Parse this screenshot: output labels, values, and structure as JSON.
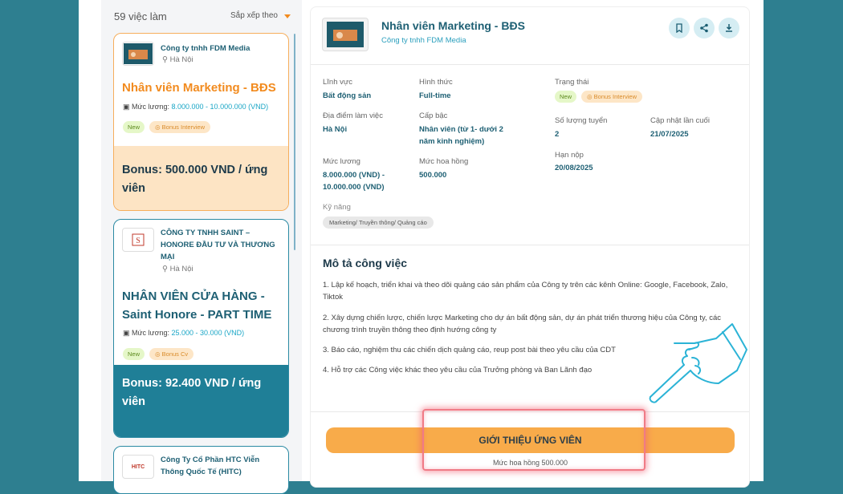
{
  "list": {
    "count": "59 việc làm",
    "sort_label": "Sắp xếp theo",
    "salary_label": "Mức lương:",
    "jobs": [
      {
        "company": "Công ty tnhh FDM Media",
        "location": "Hà Nội",
        "title": "Nhân viên Marketing - BĐS",
        "salary": "8.000.000 - 10.000.000 (VND)",
        "tag_new": "New",
        "tag_bonus": "Bonus Interview",
        "bonus": "Bonus: 500.000 VND / ứng viên"
      },
      {
        "company": "CÔNG TY TNHH SAINT – HONORE ĐẦU TƯ VÀ THƯƠNG MẠI",
        "location": "Hà Nội",
        "title": "NHÂN VIÊN CỬA HÀNG - Saint Honore - PART TIME",
        "salary": "25.000 - 30.000 (VND)",
        "tag_new": "New",
        "tag_bonus": "Bonus Cv",
        "bonus": "Bonus: 92.400 VND / ứng viên"
      },
      {
        "company": "Công Ty Cổ Phần HTC Viễn Thông Quốc Tế (HITC)",
        "logo_text": "HITC"
      }
    ]
  },
  "detail": {
    "title": "Nhân viên Marketing - BĐS",
    "company": "Công ty tnhh FDM Media",
    "fields": {
      "linh_vuc_label": "Lĩnh vực",
      "linh_vuc": "Bất động sản",
      "hinh_thuc_label": "Hình thức",
      "hinh_thuc": "Full-time",
      "trang_thai_label": "Trạng thái",
      "status_new": "New",
      "status_bonus": "Bonus Interview",
      "dia_diem_label": "Địa điểm làm việc",
      "dia_diem": "Hà Nội",
      "cap_bac_label": "Cấp bậc",
      "cap_bac": "Nhân viên (từ 1- dưới 2 năm kinh nghiệm)",
      "so_luong_label": "Số lượng tuyển",
      "so_luong": "2",
      "cap_nhat_label": "Cập nhật lần cuối",
      "cap_nhat": "21/07/2025",
      "han_nop_label": "Hạn nộp",
      "han_nop": "20/08/2025",
      "muc_luong_label": "Mức lương",
      "muc_luong": "8.000.000 (VND) - 10.000.000 (VND)",
      "hoa_hong_label": "Mức hoa hồng",
      "hoa_hong": "500.000",
      "ky_nang_label": "Kỹ năng",
      "ky_nang": "Marketing/ Truyền thông/ Quảng cáo"
    },
    "description_title": "Mô tả công việc",
    "description": [
      "1. Lập kế hoạch, triển khai và theo dõi quảng cáo sản phẩm của Công ty trên các kênh Online:  Google, Facebook, Zalo, Tiktok",
      "2. Xây dựng chiến lược, chiến lược Marketing cho dự án bất động sản, dự án phát triển thương hiệu của Công ty, các chương trình truyền thông theo định hướng công ty",
      "3. Báo cáo, nghiệm thu các chiến dịch quảng cáo, reup post bài theo yêu cầu của CDT",
      "4. Hỗ trợ các Công việc khác theo yêu cầu của Trưởng phòng và Ban Lãnh đạo"
    ],
    "cta_label": "GIỚI THIỆU ỨNG VIÊN",
    "cta_sub": "Mức hoa hồng 500.000"
  },
  "colors": {
    "background": "#2e7f90",
    "accent_orange": "#f28b1f",
    "teal": "#1d5f73",
    "cta": "#f8ab4a"
  },
  "icons": [
    "chevron-down-icon",
    "location-pin-icon",
    "money-icon",
    "coin-icon",
    "bookmark-icon",
    "share-icon",
    "download-icon",
    "pointing-hand-icon"
  ]
}
